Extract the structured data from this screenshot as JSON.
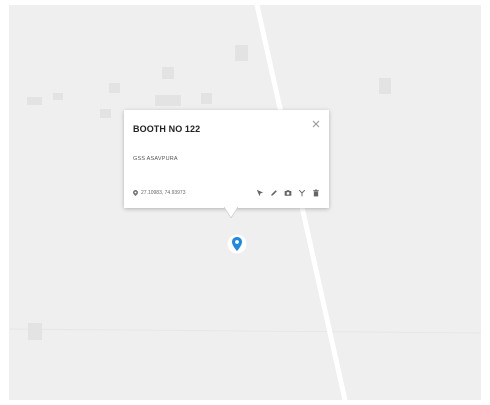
{
  "popup": {
    "title": "BOOTH NO 122",
    "subtitle": "GSS ASAVPURA",
    "coordinates": "27.10983, 74.93973",
    "close_icon": "close-icon",
    "actions": [
      {
        "name": "directions-icon"
      },
      {
        "name": "edit-icon"
      },
      {
        "name": "camera-icon"
      },
      {
        "name": "branch-icon"
      },
      {
        "name": "delete-icon"
      }
    ]
  },
  "marker": {
    "icon": "map-pin-icon",
    "color": "#1e88e5"
  },
  "colors": {
    "map_background": "#efefef",
    "building": "#e3e3e3",
    "road": "#ffffff",
    "popup_background": "#ffffff",
    "text_primary": "#222222",
    "text_secondary": "#555555",
    "icon": "#666666"
  }
}
